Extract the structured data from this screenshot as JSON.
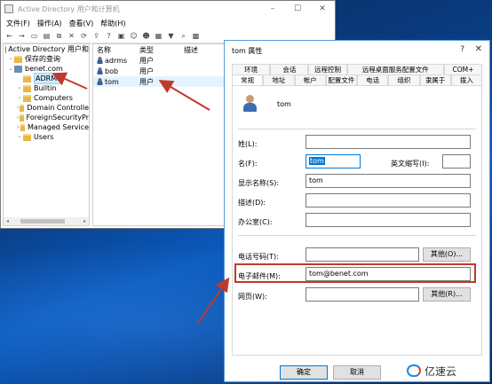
{
  "app": {
    "title": "Active Directory 用户和计算机",
    "menu": [
      "文件(F)",
      "操作(A)",
      "查看(V)",
      "帮助(H)"
    ]
  },
  "toolbar_icons": [
    "back-icon",
    "forward-icon",
    "up-icon",
    "properties-icon",
    "copy-icon",
    "delete-icon",
    "refresh-icon",
    "export-icon",
    "help-icon",
    "user-add-icon",
    "group-add-icon",
    "ou-add-icon",
    "filter-icon",
    "find-icon",
    "add-to-group-icon"
  ],
  "tree": {
    "root": "Active Directory 用户和",
    "items": [
      {
        "label": "保存的查询",
        "depth": 1,
        "arrow": "›"
      },
      {
        "label": "benet.com",
        "depth": 1,
        "arrow": "⌄"
      },
      {
        "label": "ADRMS",
        "depth": 2,
        "arrow": "",
        "selected": true
      },
      {
        "label": "Builtin",
        "depth": 2,
        "arrow": "›"
      },
      {
        "label": "Computers",
        "depth": 2,
        "arrow": "›"
      },
      {
        "label": "Domain Controlle",
        "depth": 2,
        "arrow": "›"
      },
      {
        "label": "ForeignSecurityPr",
        "depth": 2,
        "arrow": "›"
      },
      {
        "label": "Managed Service",
        "depth": 2,
        "arrow": "›"
      },
      {
        "label": "Users",
        "depth": 2,
        "arrow": "›"
      }
    ]
  },
  "list": {
    "headers": [
      "名称",
      "类型",
      "描述"
    ],
    "rows": [
      {
        "name": "adrms",
        "type": "用户"
      },
      {
        "name": "bob",
        "type": "用户"
      },
      {
        "name": "tom",
        "type": "用户"
      }
    ]
  },
  "dialog": {
    "title": "tom 属性",
    "help": "?",
    "close": "✕",
    "tabs_row1": [
      "环境",
      "会话",
      "远程控制",
      "远程桌面服务配置文件",
      "COM+"
    ],
    "tabs_row2": [
      "常规",
      "地址",
      "帐户",
      "配置文件",
      "电话",
      "组织",
      "隶属于",
      "拨入"
    ],
    "active_tab": "常规",
    "user_display": "tom",
    "fields": {
      "last_name_label": "姓(L):",
      "first_name_label": "名(F):",
      "first_name_value": "tom",
      "initials_label": "英文缩写(I):",
      "display_name_label": "显示名称(S):",
      "display_name_value": "tom",
      "description_label": "描述(D):",
      "office_label": "办公室(C):",
      "phone_label": "电话号码(T):",
      "email_label": "电子邮件(M):",
      "email_value": "tom@benet.com",
      "webpage_label": "网页(W):",
      "other_label": "其他(O)...",
      "other_label2": "其他(R)..."
    },
    "buttons": {
      "ok": "确定",
      "cancel": "取消"
    }
  },
  "watermark": {
    "text": "亿速云"
  },
  "colors": {
    "highlight": "#c0392b",
    "selection": "#cce8ff",
    "accent": "#0078d7"
  }
}
